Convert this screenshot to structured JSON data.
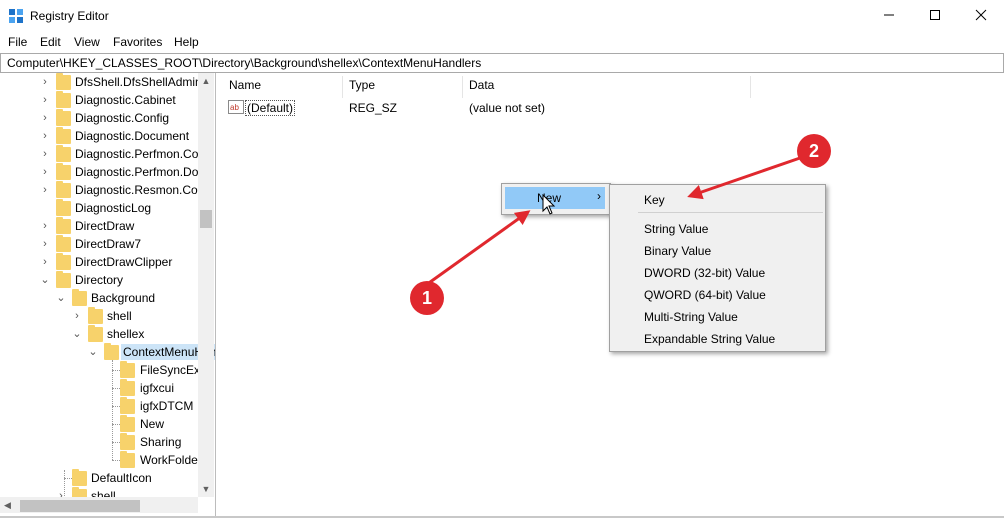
{
  "window": {
    "title": "Registry Editor",
    "controls": {
      "minimize_icon": "minimize-icon",
      "maximize_icon": "maximize-icon",
      "close_icon": "close-icon"
    }
  },
  "menubar": {
    "items": [
      "File",
      "Edit",
      "View",
      "Favorites",
      "Help"
    ]
  },
  "address": {
    "path": "Computer\\HKEY_CLASSES_ROOT\\Directory\\Background\\shellex\\ContextMenuHandlers"
  },
  "tree": {
    "items": [
      {
        "label": "DfsShell.DfsShellAdmin",
        "expander": "collapsed"
      },
      {
        "label": "Diagnostic.Cabinet",
        "expander": "collapsed"
      },
      {
        "label": "Diagnostic.Config",
        "expander": "collapsed"
      },
      {
        "label": "Diagnostic.Document",
        "expander": "collapsed"
      },
      {
        "label": "Diagnostic.Perfmon.Co",
        "expander": "collapsed"
      },
      {
        "label": "Diagnostic.Perfmon.Do",
        "expander": "collapsed"
      },
      {
        "label": "Diagnostic.Resmon.Cor",
        "expander": "collapsed"
      },
      {
        "label": "DiagnosticLog",
        "expander": "none"
      },
      {
        "label": "DirectDraw",
        "expander": "collapsed"
      },
      {
        "label": "DirectDraw7",
        "expander": "collapsed"
      },
      {
        "label": "DirectDrawClipper",
        "expander": "collapsed"
      },
      {
        "label": "Directory",
        "expander": "expanded"
      },
      {
        "label": "Background",
        "expander": "expanded"
      },
      {
        "label": "shell",
        "expander": "collapsed"
      },
      {
        "label": "shellex",
        "expander": "expanded"
      },
      {
        "label": "ContextMenuHandlers",
        "expander": "expanded",
        "selected": true
      },
      {
        "label": "FileSyncEx",
        "expander": "none"
      },
      {
        "label": "igfxcui",
        "expander": "none"
      },
      {
        "label": "igfxDTCM",
        "expander": "none"
      },
      {
        "label": "New",
        "expander": "none"
      },
      {
        "label": "Sharing",
        "expander": "none"
      },
      {
        "label": "WorkFolders",
        "expander": "none"
      },
      {
        "label": "DefaultIcon",
        "expander": "none"
      },
      {
        "label": "shell",
        "expander": "collapsed"
      }
    ]
  },
  "list": {
    "columns": [
      "Name",
      "Type",
      "Data"
    ],
    "rows": [
      {
        "icon": "string-value-icon",
        "name": "(Default)",
        "type": "REG_SZ",
        "data": "(value not set)"
      }
    ]
  },
  "context_menu": {
    "items": [
      {
        "label": "New",
        "submenu_icon": "chevron-right-icon",
        "highlighted": true
      }
    ]
  },
  "submenu": {
    "items": [
      "Key",
      "String Value",
      "Binary Value",
      "DWORD (32-bit) Value",
      "QWORD (64-bit) Value",
      "Multi-String Value",
      "Expandable String Value"
    ]
  },
  "annotations": {
    "markers": [
      {
        "label": "1"
      },
      {
        "label": "2"
      }
    ],
    "color": "#e0282e"
  },
  "colors": {
    "selection": "#cce4f7",
    "menu_highlight": "#91c9f7",
    "folder": "#f7d26b"
  }
}
